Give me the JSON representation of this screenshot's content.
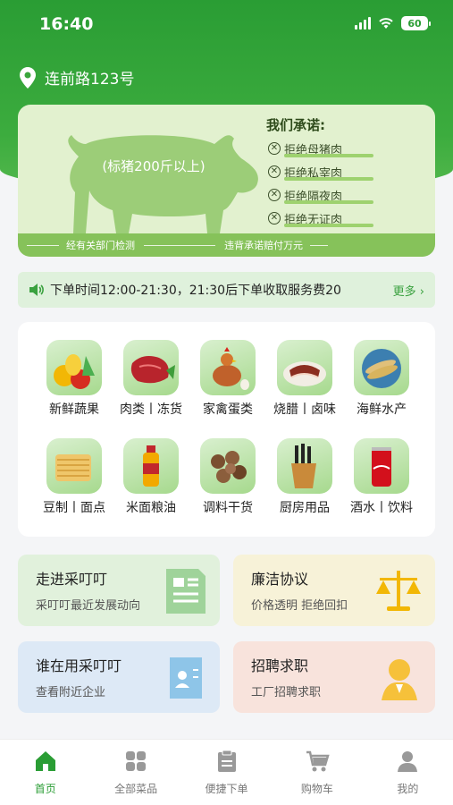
{
  "status": {
    "time": "16:40",
    "battery": "60"
  },
  "location": {
    "address": "连前路123号"
  },
  "banner": {
    "pig_text": "(标猪200斤以上)",
    "promise_title": "我们承诺:",
    "promises": [
      "拒绝母猪肉",
      "拒绝私宰肉",
      "拒绝隔夜肉",
      "拒绝无证肉"
    ],
    "footer_left": "经有关部门检测",
    "footer_right": "违背承诺赔付万元"
  },
  "notice": {
    "text": "下单时间12:00-21:30，21:30后下单收取服务费20",
    "more": "更多 ›"
  },
  "categories": [
    {
      "label": "新鲜蔬果",
      "icon": "vegetables-icon"
    },
    {
      "label": "肉类丨冻货",
      "icon": "meat-icon"
    },
    {
      "label": "家禽蛋类",
      "icon": "poultry-icon"
    },
    {
      "label": "烧腊丨卤味",
      "icon": "cured-meat-icon"
    },
    {
      "label": "海鲜水产",
      "icon": "seafood-icon"
    },
    {
      "label": "豆制丨面点",
      "icon": "tofu-noodle-icon"
    },
    {
      "label": "米面粮油",
      "icon": "oil-icon"
    },
    {
      "label": "调料干货",
      "icon": "dried-goods-icon"
    },
    {
      "label": "厨房用品",
      "icon": "knife-block-icon"
    },
    {
      "label": "酒水丨饮料",
      "icon": "cola-can-icon"
    }
  ],
  "features": [
    {
      "title": "走进采叮叮",
      "sub": "采叮叮最近发展动向",
      "bg": "#e1f1dc"
    },
    {
      "title": "廉洁协议",
      "sub": "价格透明 拒绝回扣",
      "bg": "#f7f2d8"
    },
    {
      "title": "谁在用采叮叮",
      "sub": "查看附近企业",
      "bg": "#dde9f6"
    },
    {
      "title": "招聘求职",
      "sub": "工厂招聘求职",
      "bg": "#f8e3dc"
    }
  ],
  "tabs": [
    {
      "label": "首页",
      "icon": "home-icon",
      "active": true
    },
    {
      "label": "全部菜品",
      "icon": "grid-icon",
      "active": false
    },
    {
      "label": "便捷下单",
      "icon": "clipboard-icon",
      "active": false
    },
    {
      "label": "购物车",
      "icon": "cart-icon",
      "active": false
    },
    {
      "label": "我的",
      "icon": "user-icon",
      "active": false
    }
  ],
  "colors": {
    "brand_green": "#2a9d34",
    "banner_bg": "#e2f1cf"
  }
}
